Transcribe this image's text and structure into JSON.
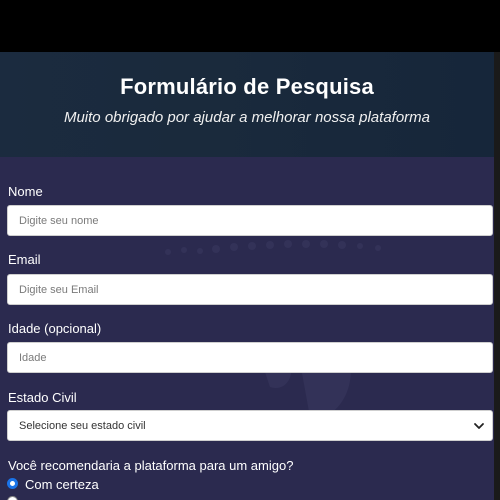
{
  "header": {
    "title": "Formulário de Pesquisa",
    "subtitle": "Muito obrigado por ajudar a melhorar nossa plataforma"
  },
  "form": {
    "name": {
      "label": "Nome",
      "placeholder": "Digite seu nome",
      "value": ""
    },
    "email": {
      "label": "Email",
      "placeholder": "Digite seu Email",
      "value": ""
    },
    "age": {
      "label": "Idade (opcional)",
      "placeholder": "Idade",
      "value": ""
    },
    "marital": {
      "label": "Estado Civil",
      "selected": "Selecione seu estado civil"
    },
    "recommend": {
      "question": "Você recomendaria a plataforma para um amigo?",
      "options": [
        {
          "label": "Com certeza",
          "checked": true
        }
      ]
    }
  },
  "colors": {
    "page_bg": "#2b2a4f",
    "header_bg": "#1b2b3f",
    "radio_accent": "#1a73e8"
  }
}
